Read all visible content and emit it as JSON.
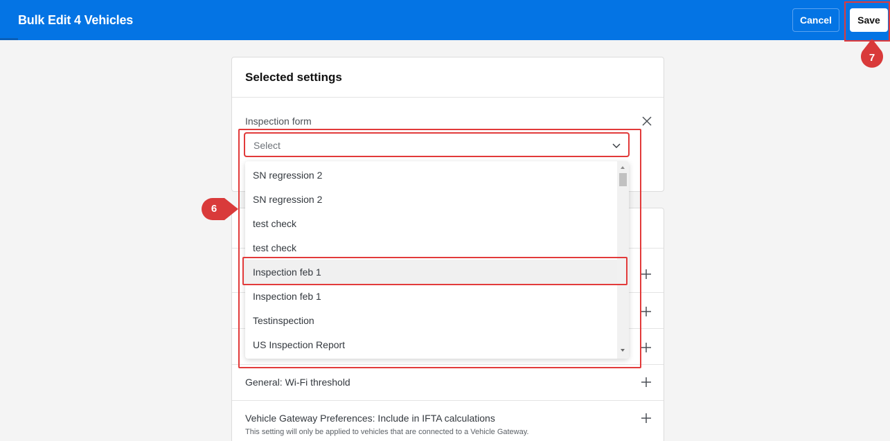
{
  "header": {
    "title": "Bulk Edit 4 Vehicles",
    "cancel_label": "Cancel",
    "save_label": "Save"
  },
  "selected_settings": {
    "heading": "Selected settings",
    "inspection_form": {
      "label": "Inspection form",
      "select_placeholder": "Select",
      "options": [
        "SN regression 2",
        "SN regression 2",
        "test check",
        "test check",
        "Inspection feb 1",
        "Inspection feb 1",
        "Testinspection",
        "US Inspection Report"
      ],
      "highlighted_index": 4
    }
  },
  "available_settings": {
    "rows": [
      {
        "label": "General: Wi-Fi threshold",
        "sub": ""
      },
      {
        "label": "Vehicle Gateway Preferences: Include in IFTA calculations",
        "sub": "This setting will only be applied to vehicles that are connected to a Vehicle Gateway."
      }
    ]
  },
  "annotations": {
    "step_6": "6",
    "step_7": "7"
  },
  "colors": {
    "header_blue": "#0474e4",
    "highlight_red": "#e23a3a",
    "marker_red": "#d93a3a"
  }
}
